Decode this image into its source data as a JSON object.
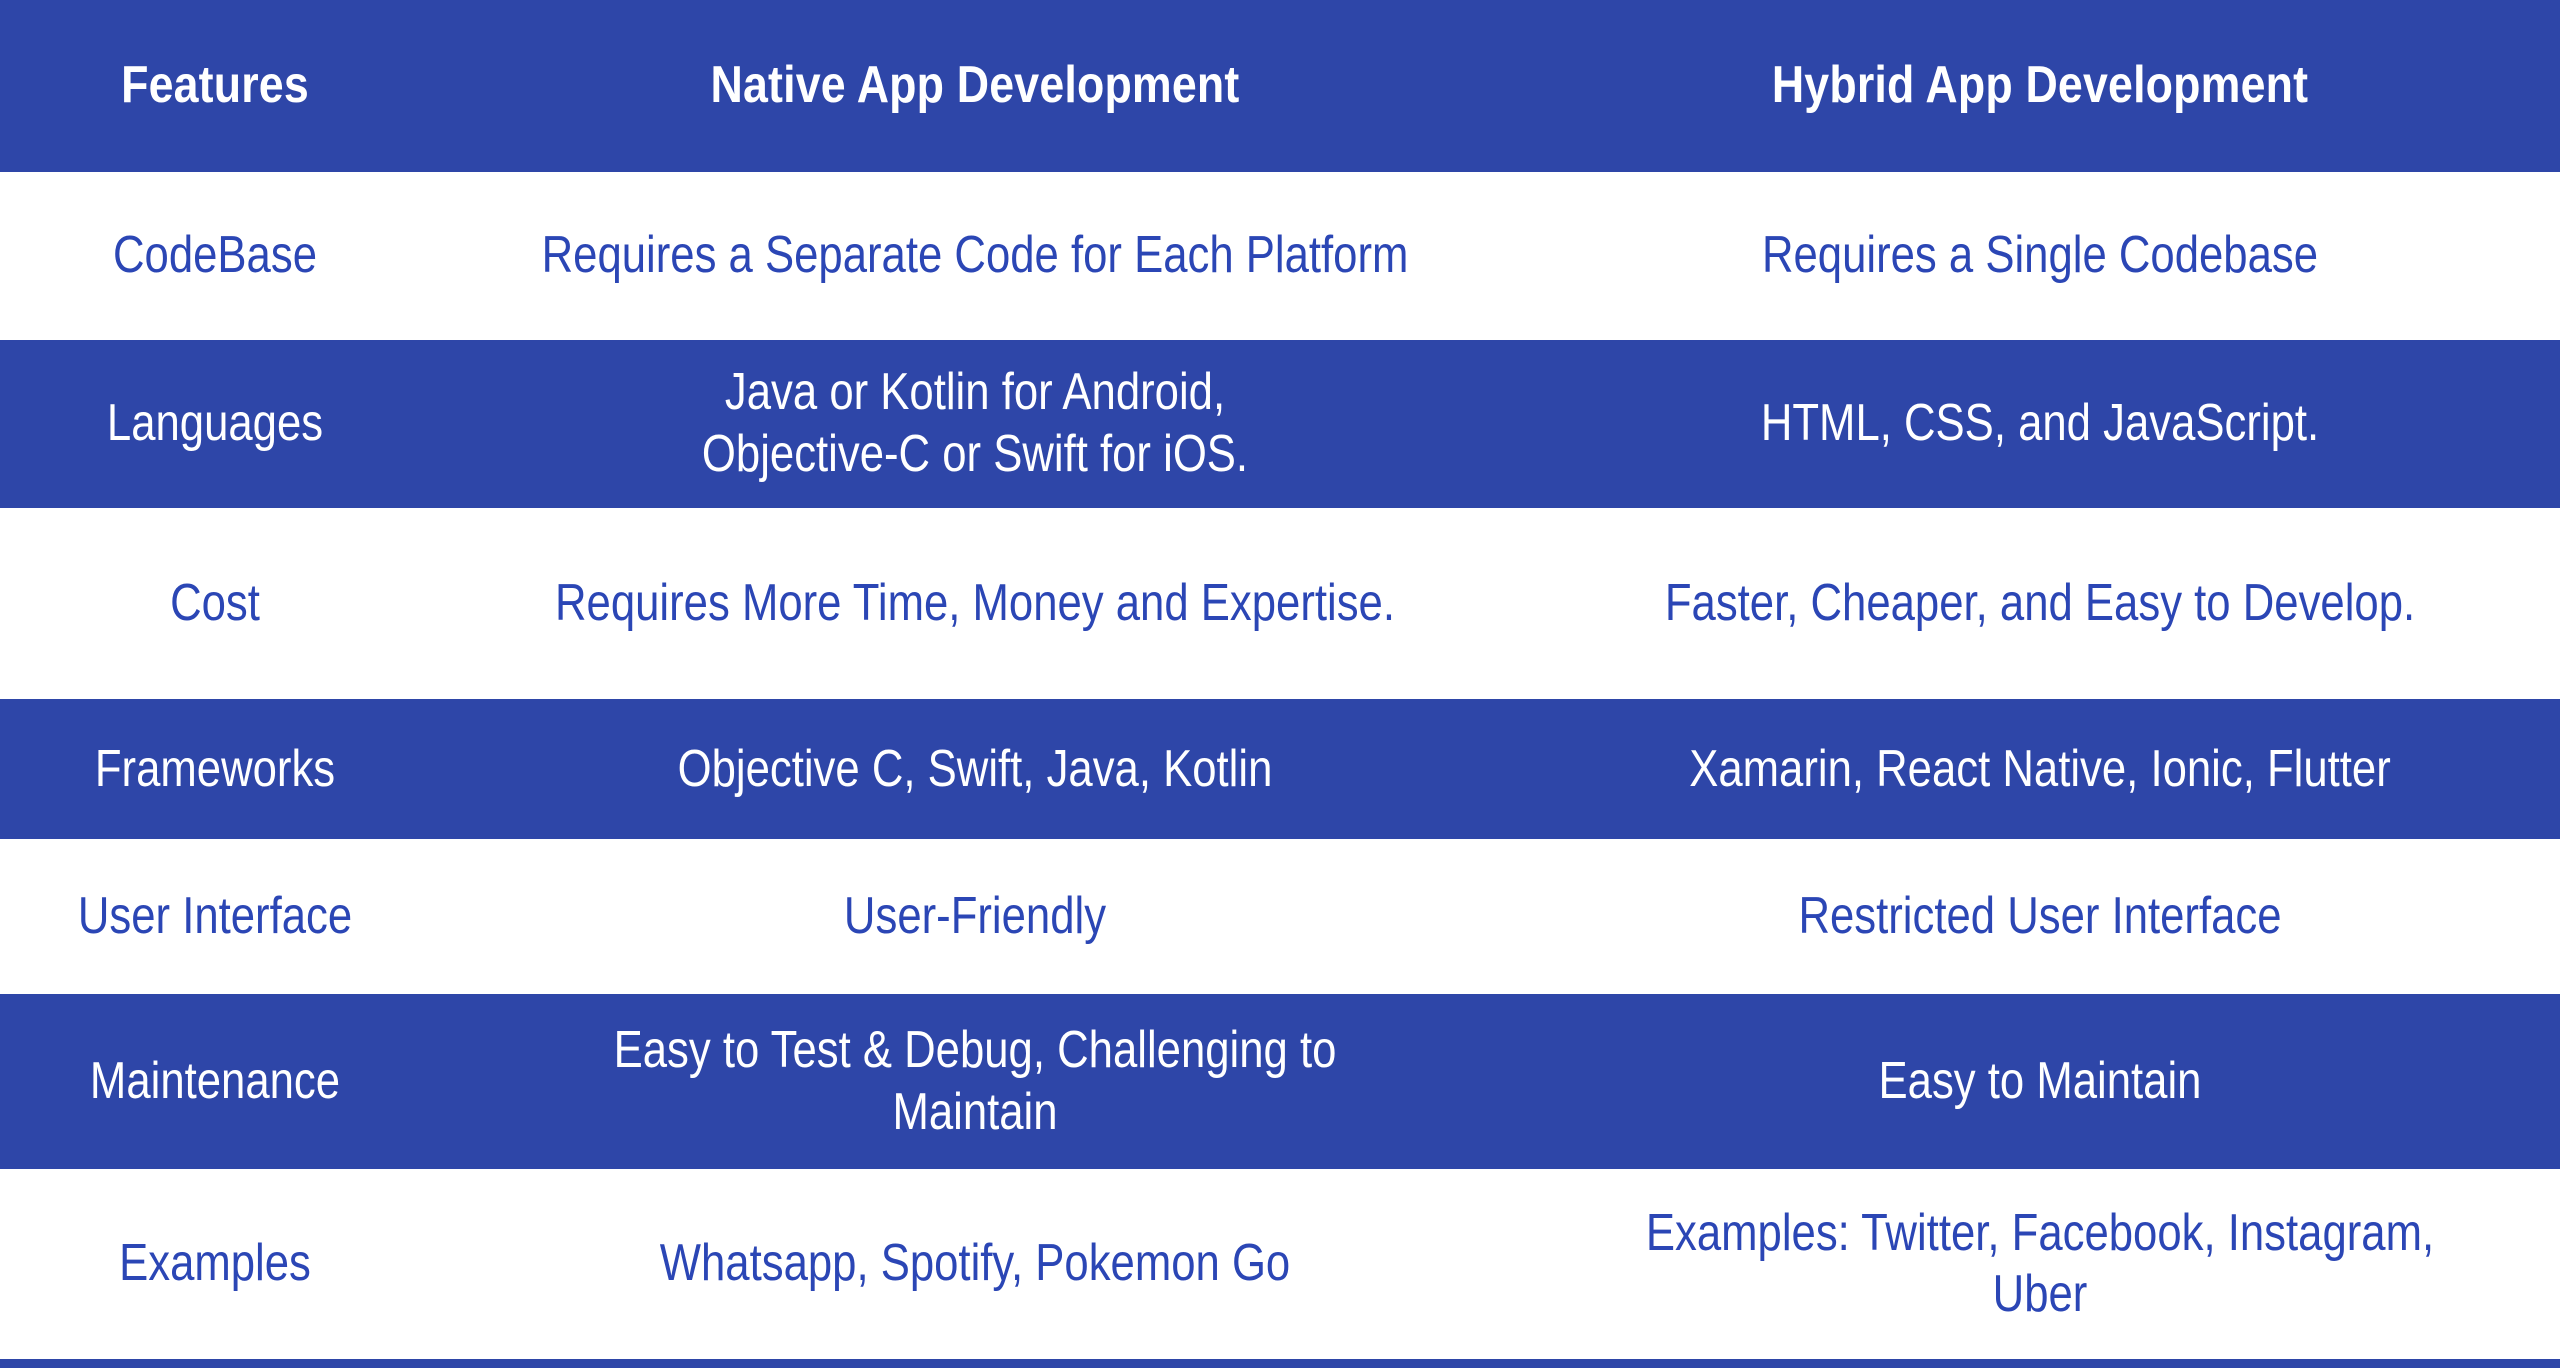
{
  "colors": {
    "header_background": "#2e46a8",
    "dark_row_background": "#2e46a8",
    "light_row_background": "#ffffff",
    "light_row_text": "#2b46b5",
    "dark_row_text": "#ffffff",
    "bottom_rule": "#2e46a8"
  },
  "table": {
    "headers": {
      "feature": "Features",
      "native": "Native App Development",
      "hybrid": "Hybrid App Development"
    },
    "rows": [
      {
        "feature": "CodeBase",
        "native": "Requires a Separate Code for Each Platform",
        "hybrid": "Requires a Single Codebase",
        "style": "light"
      },
      {
        "feature": "Languages",
        "native": "Java or Kotlin for Android,\nObjective-C or Swift for iOS.",
        "hybrid": "HTML, CSS, and JavaScript.",
        "style": "dark"
      },
      {
        "feature": "Cost",
        "native": "Requires More Time, Money and Expertise.",
        "hybrid": "Faster, Cheaper, and Easy to Develop.",
        "style": "light"
      },
      {
        "feature": "Frameworks",
        "native": "Objective C, Swift, Java, Kotlin",
        "hybrid": "Xamarin, React Native, Ionic, Flutter",
        "style": "dark"
      },
      {
        "feature": "User Interface",
        "native": "User-Friendly",
        "hybrid": "Restricted User Interface",
        "style": "light"
      },
      {
        "feature": "Maintenance",
        "native": "Easy to Test & Debug, Challenging to Maintain",
        "hybrid": "Easy to Maintain",
        "style": "dark"
      },
      {
        "feature": "Examples",
        "native": "Whatsapp, Spotify, Pokemon Go",
        "hybrid": "Examples: Twitter, Facebook, Instagram, Uber",
        "style": "light"
      }
    ]
  }
}
